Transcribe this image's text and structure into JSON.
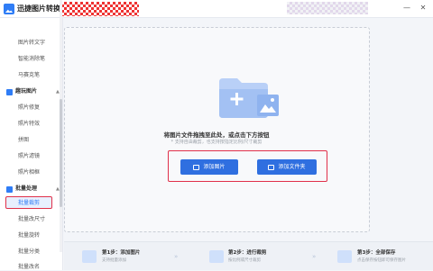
{
  "app": {
    "title": "迅捷图片转换器",
    "window_controls": [
      "—",
      "✕"
    ]
  },
  "sidebar": {
    "top_items": [
      "图片转文字",
      "智能消除笔",
      "马赛克笔"
    ],
    "groups": [
      {
        "label": "趣玩图片",
        "items": [
          "照片修复",
          "照片特效",
          "拼图",
          "照片滤镜",
          "照片相框"
        ]
      },
      {
        "label": "批量处理",
        "items": [
          "批量裁剪",
          "批量改尺寸",
          "批量旋转",
          "批量分类",
          "批量改名"
        ]
      }
    ],
    "active_item": "批量裁剪"
  },
  "drop_zone": {
    "main_text": "将图片文件拖拽至此处，或点击下方按钮",
    "sub_text": "* 支持自由裁剪，也支持按指定比例/尺寸裁剪",
    "add_image_label": "添加图片",
    "add_folder_label": "添加文件夹"
  },
  "steps": [
    {
      "title": "第1步：添加图片",
      "desc": "支持批量添加"
    },
    {
      "title": "第2步：进行裁剪",
      "desc": "按比例或尺寸裁剪"
    },
    {
      "title": "第3步：全部保存",
      "desc": "点击保存按钮即可保存图片"
    }
  ],
  "colors": {
    "accent": "#2f6fe0",
    "highlight_frame": "#e0304a",
    "sidebar_active_bg": "#e8f0fe"
  }
}
